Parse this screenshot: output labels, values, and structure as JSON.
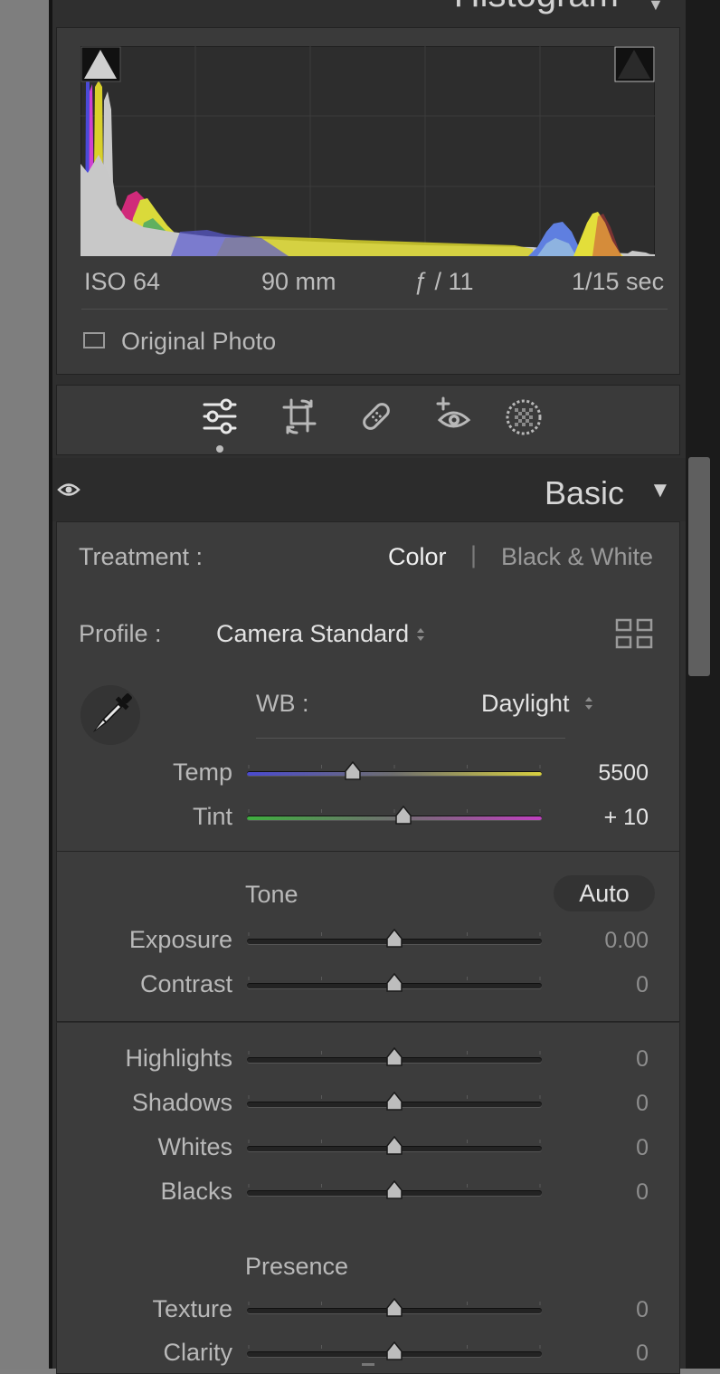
{
  "histogram": {
    "title": "Histogram",
    "meta": {
      "iso": "ISO 64",
      "focal": "90 mm",
      "aperture": "ƒ / 11",
      "shutter": "1/15 sec"
    },
    "original_photo_label": "Original Photo"
  },
  "tools": [
    "edit-sliders",
    "crop",
    "healing",
    "red-eye",
    "masking"
  ],
  "basic": {
    "title": "Basic",
    "treatment": {
      "label": "Treatment :",
      "options": [
        "Color",
        "|",
        "Black & White"
      ],
      "selected": "Color"
    },
    "profile": {
      "label": "Profile :",
      "value": "Camera Standard"
    },
    "wb": {
      "label": "WB :",
      "value": "Daylight"
    },
    "sliders_wb": [
      {
        "label": "Temp",
        "value": "5500",
        "position": 0.36
      },
      {
        "label": "Tint",
        "value": "+ 10",
        "position": 0.53
      }
    ],
    "tone": {
      "title": "Tone",
      "auto_label": "Auto",
      "sliders": [
        {
          "label": "Exposure",
          "value": "0.00",
          "position": 0.5
        },
        {
          "label": "Contrast",
          "value": "0",
          "position": 0.5
        }
      ]
    },
    "tone2": {
      "sliders": [
        {
          "label": "Highlights",
          "value": "0",
          "position": 0.5
        },
        {
          "label": "Shadows",
          "value": "0",
          "position": 0.5
        },
        {
          "label": "Whites",
          "value": "0",
          "position": 0.5
        },
        {
          "label": "Blacks",
          "value": "0",
          "position": 0.5
        }
      ]
    },
    "presence": {
      "title": "Presence",
      "sliders": [
        {
          "label": "Texture",
          "value": "0",
          "position": 0.5
        },
        {
          "label": "Clarity",
          "value": "0",
          "position": 0.5
        }
      ]
    }
  },
  "colors": {
    "panel": "#2f2f2f",
    "section": "#3c3c3c",
    "temp_gradient": [
      "#4a4ad0",
      "#d8d040"
    ],
    "tint_gradient": [
      "#3fae3f",
      "#c040c0"
    ]
  }
}
